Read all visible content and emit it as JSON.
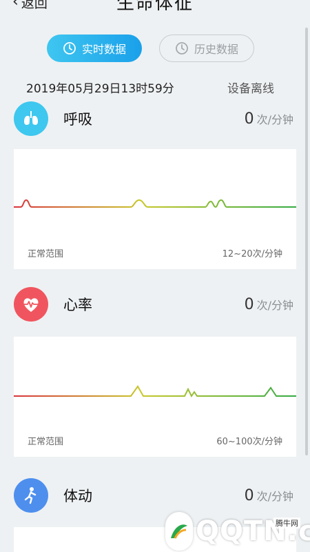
{
  "header": {
    "back_label": "返回",
    "title": "生命体征"
  },
  "tabs": [
    {
      "label": "实时数据",
      "active": true
    },
    {
      "label": "历史数据",
      "active": false
    }
  ],
  "status": {
    "timestamp": "2019年05月29日13时59分",
    "device_state": "设备离线"
  },
  "metrics": [
    {
      "label": "呼吸",
      "value": "0",
      "unit": "次/分钟",
      "icon": "lungs-icon",
      "icon_color": "#3ec7ef",
      "range_label": "正常范围",
      "range_value": "12~20次/分钟"
    },
    {
      "label": "心率",
      "value": "0",
      "unit": "次/分钟",
      "icon": "heart-pulse-icon",
      "icon_color": "#f0555f",
      "range_label": "正常范围",
      "range_value": "60~100次/分钟"
    },
    {
      "label": "体动",
      "value": "0",
      "unit": "次/分钟",
      "icon": "person-running-icon",
      "icon_color": "#4e8fee"
    }
  ],
  "colors": {
    "accent": "#1aa0ea",
    "line_start": "#d8333b",
    "line_mid": "#c8c82a",
    "line_end": "#33aa44"
  },
  "watermark": {
    "text": "QQTN.com",
    "small_text": "腾牛网"
  }
}
